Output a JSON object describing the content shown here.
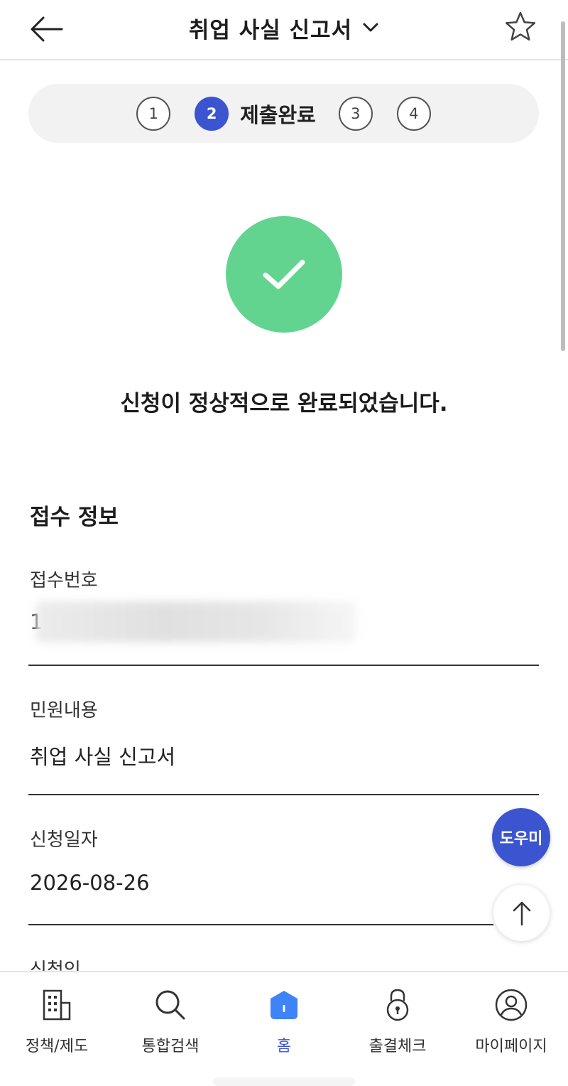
{
  "header": {
    "title": "취업 사실 신고서"
  },
  "stepper": {
    "steps": [
      "1",
      "2",
      "3",
      "4"
    ],
    "active_label": "제출완료"
  },
  "success": {
    "message": "신청이 정상적으로 완료되었습니다."
  },
  "receipt": {
    "section_title": "접수 정보",
    "fields": [
      {
        "label": "접수번호",
        "value": "1"
      },
      {
        "label": "민원내용",
        "value": "취업 사실 신고서"
      },
      {
        "label": "신청일자",
        "value": "2026-08-26"
      },
      {
        "label": "신청인",
        "value": ""
      }
    ]
  },
  "floating": {
    "help_label": "도우미"
  },
  "bottom_nav": {
    "items": [
      {
        "label": "정책/제도",
        "icon": "building-icon"
      },
      {
        "label": "통합검색",
        "icon": "search-icon"
      },
      {
        "label": "홈",
        "icon": "home-icon",
        "active": true
      },
      {
        "label": "출결체크",
        "icon": "lock-icon"
      },
      {
        "label": "마이페이지",
        "icon": "user-circle-icon"
      }
    ]
  },
  "colors": {
    "accent": "#3b55d1",
    "success": "#62d48f",
    "home_icon": "#3f83f8"
  }
}
